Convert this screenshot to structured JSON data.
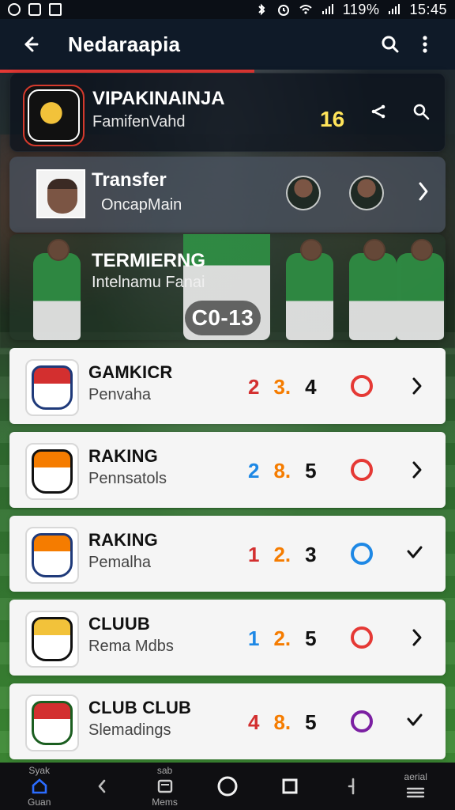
{
  "status": {
    "battery": "119%",
    "time": "15:45"
  },
  "appbar": {
    "title": "Nedaraapia"
  },
  "featured": [
    {
      "title": "VIPAKINAINJA",
      "subtitle": "FamifenVahd",
      "number": "16"
    },
    {
      "title": "Transfer",
      "subtitle": "OncapMain"
    },
    {
      "title": "TERMIERNG",
      "subtitle": "Intelnamu Fanai",
      "score": "C0-13"
    }
  ],
  "list": [
    {
      "name": "GAMKICR",
      "sub": "Penvaha",
      "n1": "2",
      "n2": "3.",
      "n3": "4",
      "ring_color": "#e53935",
      "end_icon": "chevron-right-icon"
    },
    {
      "name": "RAKING",
      "sub": "Pennsatols",
      "n1": "2",
      "n2": "8.",
      "n3": "5",
      "ring_color": "#e53935",
      "end_icon": "chevron-right-icon"
    },
    {
      "name": "RAKING",
      "sub": "Pemalha",
      "n1": "1",
      "n2": "2.",
      "n3": "3",
      "ring_color": "#1e88e5",
      "end_icon": "checkmark-icon"
    },
    {
      "name": "CLUUB",
      "sub": "Rema Mdbs",
      "n1": "1",
      "n2": "2.",
      "n3": "5",
      "ring_color": "#e53935",
      "end_icon": "chevron-right-icon"
    },
    {
      "name": "CLUB CLUB",
      "sub": "Slemadings",
      "n1": "4",
      "n2": "8.",
      "n3": "5",
      "ring_color": "#7b1fa2",
      "end_icon": "checkmark-icon"
    }
  ],
  "colors": {
    "accent": "#e53935",
    "highlight": "#ffe45a",
    "num_red": "#d32f2f",
    "num_orange": "#f57c00",
    "num_blue": "#1e88e5"
  },
  "navbar": {
    "left_label_top": "Syak",
    "left_label": "Guan",
    "mid_label_top": "sab",
    "mid_label": "Mems",
    "right_label_top": "aerial"
  }
}
